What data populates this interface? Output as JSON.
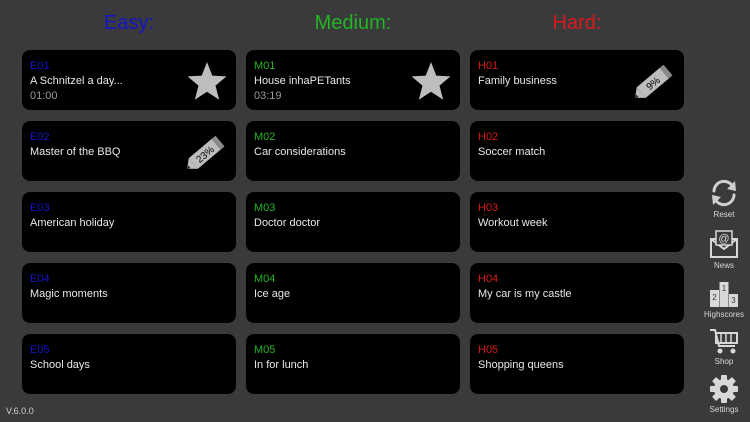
{
  "columns": [
    {
      "heading": "Easy:",
      "color": "#1515c8"
    },
    {
      "heading": "Medium:",
      "color": "#22b422"
    },
    {
      "heading": "Hard:",
      "color": "#d61a1a"
    }
  ],
  "levels": {
    "easy": [
      {
        "code": "E01",
        "title": "A Schnitzel a day...",
        "time": "01:00",
        "badge": "star-icon"
      },
      {
        "code": "E02",
        "title": "Master of the BBQ",
        "badge": "pencil-icon",
        "progress": "23%"
      },
      {
        "code": "E03",
        "title": "American holiday"
      },
      {
        "code": "E04",
        "title": "Magic moments"
      },
      {
        "code": "E05",
        "title": "School days"
      }
    ],
    "medium": [
      {
        "code": "M01",
        "title": "House inhaPETants",
        "time": "03:19",
        "badge": "star-icon"
      },
      {
        "code": "M02",
        "title": "Car considerations"
      },
      {
        "code": "M03",
        "title": "Doctor doctor"
      },
      {
        "code": "M04",
        "title": "Ice age"
      },
      {
        "code": "M05",
        "title": "In for lunch"
      }
    ],
    "hard": [
      {
        "code": "H01",
        "title": "Family business",
        "badge": "pencil-icon",
        "progress": "9%"
      },
      {
        "code": "H02",
        "title": "Soccer match"
      },
      {
        "code": "H03",
        "title": "Workout week"
      },
      {
        "code": "H04",
        "title": "My car is my castle"
      },
      {
        "code": "H05",
        "title": "Shopping queens"
      }
    ]
  },
  "sidebar": {
    "reset": {
      "label": "Reset",
      "icon": "reset-icon"
    },
    "news": {
      "label": "News",
      "icon": "news-icon"
    },
    "highscores": {
      "label": "Highscores",
      "icon": "highscores-icon",
      "podium": [
        "2",
        "1",
        "3"
      ]
    },
    "shop": {
      "label": "Shop",
      "icon": "cart-icon"
    },
    "settings": {
      "label": "Settings",
      "icon": "gear-icon"
    }
  },
  "version": "V.6.0.0",
  "colors": {
    "background": "#3a3a3c",
    "card": "#000000",
    "badge": "#bdbdbd"
  }
}
